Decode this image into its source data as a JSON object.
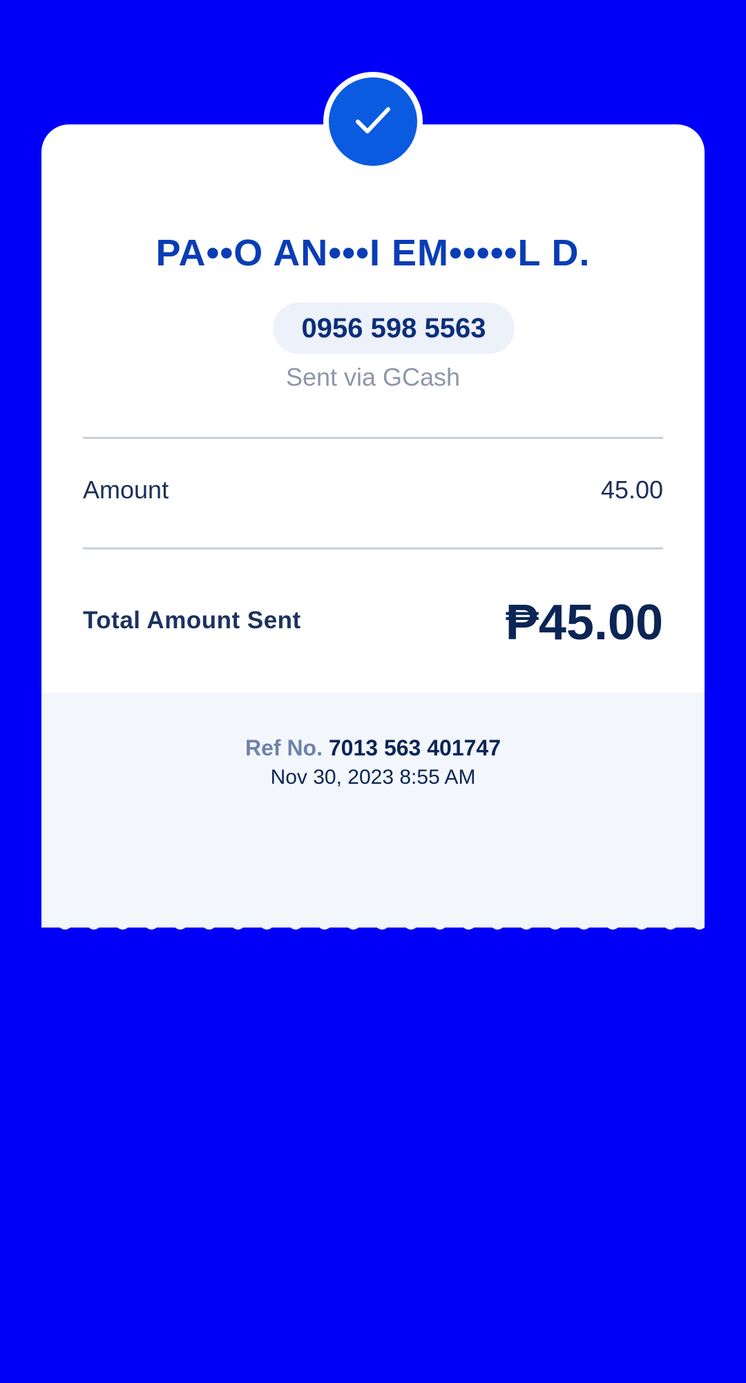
{
  "colors": {
    "background": "#0000F8",
    "accent": "#0A5BE0",
    "name_text": "#0A3DB5",
    "dark_text": "#0B2555",
    "muted_text": "#8D97A8"
  },
  "header": {
    "icon": "checkmark-icon"
  },
  "recipient": {
    "name": "PA••O AN•••I EM•••••L D.",
    "phone": "0956 598 5563",
    "channel": "Sent via GCash"
  },
  "details": {
    "amount_label": "Amount",
    "amount_value": "45.00"
  },
  "total": {
    "label": "Total Amount Sent",
    "value": "₱45.00"
  },
  "reference": {
    "label": "Ref No.",
    "number": "7013 563 401747",
    "datetime": "Nov 30, 2023 8:55 AM"
  }
}
